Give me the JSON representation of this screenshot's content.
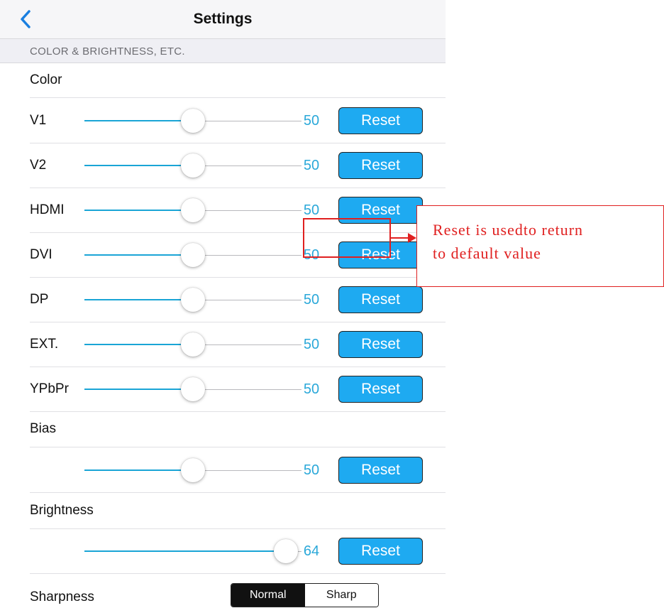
{
  "nav": {
    "title": "Settings",
    "back_icon": "chevron-left-icon"
  },
  "section_header": "COLOR & BRIGHTNESS, ETC.",
  "color_header": "Color",
  "color_rows": [
    {
      "label": "V1",
      "value": "50",
      "level": 0.5,
      "reset": "Reset"
    },
    {
      "label": "V2",
      "value": "50",
      "level": 0.5,
      "reset": "Reset"
    },
    {
      "label": "HDMI",
      "value": "50",
      "level": 0.5,
      "reset": "Reset"
    },
    {
      "label": "DVI",
      "value": "50",
      "level": 0.5,
      "reset": "Reset"
    },
    {
      "label": "DP",
      "value": "50",
      "level": 0.5,
      "reset": "Reset"
    },
    {
      "label": "EXT.",
      "value": "50",
      "level": 0.5,
      "reset": "Reset"
    },
    {
      "label": "YPbPr",
      "value": "50",
      "level": 0.5,
      "reset": "Reset"
    }
  ],
  "bias": {
    "header": "Bias",
    "value": "50",
    "level": 0.5,
    "reset": "Reset"
  },
  "brightness": {
    "header": "Brightness",
    "value": "64",
    "level": 0.98,
    "reset": "Reset"
  },
  "sharpness": {
    "label": "Sharpness",
    "options": [
      "Normal",
      "Sharp"
    ],
    "selected": "Normal"
  },
  "annotation": {
    "line1": "Reset is usedto return",
    "line2": "to default value",
    "color": "#e02020"
  },
  "colors": {
    "accent": "#1eaaf1",
    "value_text": "#2aa8d9",
    "track_min": "#1aa5d6"
  }
}
